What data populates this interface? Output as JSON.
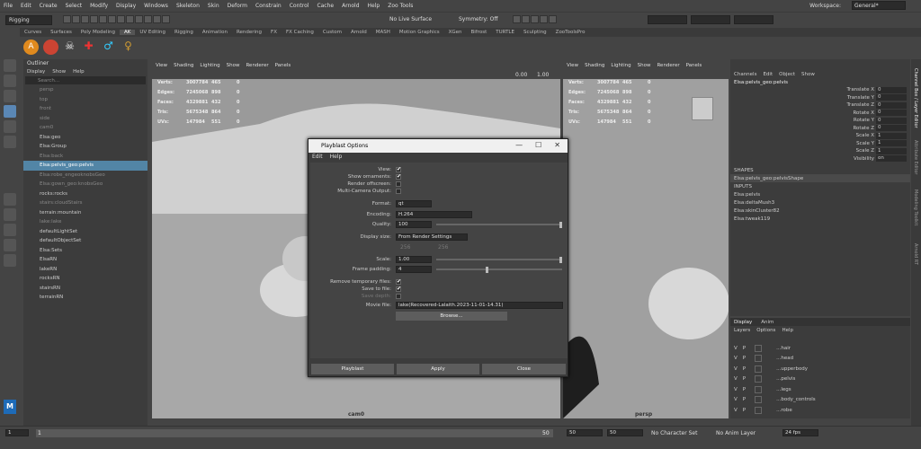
{
  "menubar": {
    "items": [
      "File",
      "Edit",
      "Create",
      "Select",
      "Modify",
      "Display",
      "Windows",
      "Skeleton",
      "Skin",
      "Deform",
      "Constrain",
      "Control",
      "Cache",
      "Arnold",
      "Help",
      "Zoo Tools"
    ],
    "workspace_label": "Workspace:",
    "workspace_value": "General*"
  },
  "statusline": {
    "mode": "Rigging",
    "live_surface": "No Live Surface",
    "symmetry": "Symmetry: Off"
  },
  "shelf": {
    "tabs": [
      "Curves",
      "Surfaces",
      "Poly Modeling",
      "AK",
      "UV Editing",
      "Rigging",
      "Animation",
      "Rendering",
      "FX",
      "FX Caching",
      "Custom",
      "Arnold",
      "MASH",
      "Motion Graphics",
      "XGen",
      "Bifrost",
      "TURTLE",
      "Sculpting",
      "ZooToolsPro"
    ],
    "active": "AK"
  },
  "outliner": {
    "title": "Outliner",
    "menu": [
      "Display",
      "Show",
      "Help"
    ],
    "search_placeholder": "Search...",
    "items": [
      {
        "label": "persp",
        "dim": true
      },
      {
        "label": "top",
        "dim": true
      },
      {
        "label": "front",
        "dim": true
      },
      {
        "label": "side",
        "dim": true
      },
      {
        "label": "cam0",
        "dim": true
      },
      {
        "label": "Elsa:geo",
        "dim": false
      },
      {
        "label": "Elsa:Group",
        "dim": false
      },
      {
        "label": "Elsa:back",
        "dim": true
      },
      {
        "label": "Elsa:pelvis_geo:pelvis",
        "dim": false,
        "selected": true
      },
      {
        "label": "Elsa:robe_engeoknobsGeo",
        "dim": true
      },
      {
        "label": "Elsa:gown_geo:knobsGeo",
        "dim": true
      },
      {
        "label": "rocks:rocks",
        "dim": false
      },
      {
        "label": "stairs:cloudStairs",
        "dim": true
      },
      {
        "label": "terrain:mountain",
        "dim": false
      },
      {
        "label": "lake:lake",
        "dim": true
      },
      {
        "label": "defaultLightSet",
        "dim": false
      },
      {
        "label": "defaultObjectSet",
        "dim": false
      },
      {
        "label": "Elsa:Sets",
        "dim": false
      },
      {
        "label": "ElsaRN",
        "dim": false
      },
      {
        "label": "lakeRN",
        "dim": false
      },
      {
        "label": "rocksRN",
        "dim": false
      },
      {
        "label": "stairsRN",
        "dim": false
      },
      {
        "label": "terrainRN",
        "dim": false
      }
    ]
  },
  "viewport_menu": [
    "View",
    "Shading",
    "Lighting",
    "Show",
    "Renderer",
    "Panels"
  ],
  "hud": {
    "rows": [
      [
        "Verts:",
        "3007784",
        "465",
        "0"
      ],
      [
        "Edges:",
        "7245068",
        "898",
        "0"
      ],
      [
        "Faces:",
        "4329881",
        "432",
        "0"
      ],
      [
        "Tris:",
        "5675348",
        "864",
        "0"
      ],
      [
        "UVs:",
        "147984",
        "551",
        "0"
      ]
    ]
  },
  "viewport_left_label": "cam0",
  "viewport_right_label": "persp",
  "right_toolbar": {
    "value1": "0.00",
    "value2": "1.00"
  },
  "dialog": {
    "title": "Playblast Options",
    "menu": [
      "Edit",
      "Help"
    ],
    "labels": {
      "view": "View:",
      "show_ornaments": "Show ornaments:",
      "render_offscreen": "Render offscreen:",
      "multi_camera": "Multi-Camera Output:",
      "format": "Format:",
      "encoding": "Encoding:",
      "quality": "Quality:",
      "display_size": "Display size:",
      "scale": "Scale:",
      "frame_padding": "Frame padding:",
      "remove_temp": "Remove temporary files:",
      "save_to_file": "Save to file:",
      "save_depth": "Save depth:",
      "movie_file": "Movie file:"
    },
    "format_value": "qt",
    "encoding_value": "H.264",
    "quality_value": "100",
    "display_size_value": "From Render Settings",
    "width_value": "256",
    "height_value": "256",
    "scale_value": "1.00",
    "frame_padding_value": "4",
    "movie_file_value": "lake(Recovered-Lalaith.2023-11-01-14.31)",
    "browse": "Browse...",
    "playblast": "Playblast",
    "apply": "Apply",
    "close": "Close",
    "quality_fill": 1.0,
    "scale_fill": 1.0,
    "padding_fill": 0.4
  },
  "channelbox": {
    "menu": [
      "Channels",
      "Edit",
      "Object",
      "Show"
    ],
    "object": "Elsa:pelvis_geo:pelvis",
    "channels": [
      [
        "Translate X",
        "0"
      ],
      [
        "Translate Y",
        "0"
      ],
      [
        "Translate Z",
        "0"
      ],
      [
        "Rotate X",
        "0"
      ],
      [
        "Rotate Y",
        "0"
      ],
      [
        "Rotate Z",
        "0"
      ],
      [
        "Scale X",
        "1"
      ],
      [
        "Scale Y",
        "1"
      ],
      [
        "Scale Z",
        "1"
      ],
      [
        "Visibility",
        "on"
      ]
    ],
    "shapes_label": "SHAPES",
    "shape": "Elsa:pelvis_geo:pelvisShape",
    "inputs_label": "INPUTS",
    "inputs": [
      "Elsa:pelvis",
      "Elsa:deltaMush3",
      "Elsa:skinCluster82",
      "Elsa:tweak119"
    ],
    "side_tabs": [
      "Channel Box / Layer Editor",
      "Attribute Editor",
      "Modeling Toolkit",
      "Arnold RT"
    ]
  },
  "layers": {
    "tabs": [
      "Display",
      "Anim"
    ],
    "menu": [
      "Layers",
      "Options",
      "Help"
    ],
    "items": [
      "...hair",
      "...head",
      "...upperbody",
      "...pelvis",
      "...legs",
      "...body_controls",
      "...robe"
    ],
    "v": "V",
    "p": "P"
  },
  "timeline": {
    "start": "1",
    "current": "1",
    "end_field": "50",
    "range_start": "50",
    "range_end": "50",
    "char_set": "No Character Set",
    "anim_layer": "No Anim Layer",
    "fps": "24 fps"
  }
}
